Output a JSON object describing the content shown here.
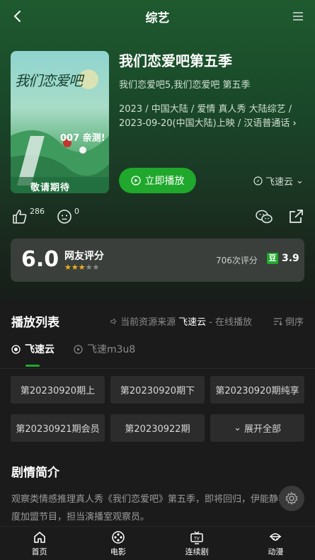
{
  "header": {
    "title": "综艺"
  },
  "show": {
    "poster_title": "我们恋爱吧",
    "poster_mid": "007 亲测!",
    "poster_foot": "敬请期待",
    "title": "我们恋爱吧第五季",
    "alias": "我们恋爱吧5,我们恋爱吧 第五季",
    "meta_line1": "2023 / 中国大陆 / 爱情 真人秀 大陆综艺 /",
    "meta_line2": "2023-09-20(中国大陆)上映 / 汉语普通话",
    "play_label": "立即播放",
    "source_label": "飞速云"
  },
  "actions": {
    "likes": "286",
    "dislikes": "0"
  },
  "rating": {
    "score": "6.0",
    "label": "网友评分",
    "stars": 3,
    "votes": "706次评分",
    "douban_badge": "豆",
    "douban_score": "3.9"
  },
  "playlist": {
    "title": "播放列表",
    "source_prefix": "当前资源来源",
    "source_name": "飞速云",
    "source_suffix": " - 在线播放",
    "sort_label": "倒序",
    "tabs": [
      {
        "label": "飞速云",
        "active": true
      },
      {
        "label": "飞速m3u8",
        "active": false
      }
    ],
    "episodes": [
      "第20230920期上",
      "第20230920期下",
      "第20230920期纯享",
      "第20230921期会员",
      "第20230922期"
    ],
    "expand_label": "展开全部"
  },
  "synopsis": {
    "title": "剧情简介",
    "text": "观察类情感推理真人秀《我们恋爱吧》第五季，即将回归，伊能静将再度加盟节目，担当演播室观察员。"
  },
  "bottom_nav": [
    {
      "label": "首页",
      "icon": "home-icon"
    },
    {
      "label": "电影",
      "icon": "film-reel-icon"
    },
    {
      "label": "连续剧",
      "icon": "tv-icon"
    },
    {
      "label": "动漫",
      "icon": "anime-icon"
    }
  ],
  "colors": {
    "accent": "#1fa82c",
    "star": "#f3b21d"
  }
}
